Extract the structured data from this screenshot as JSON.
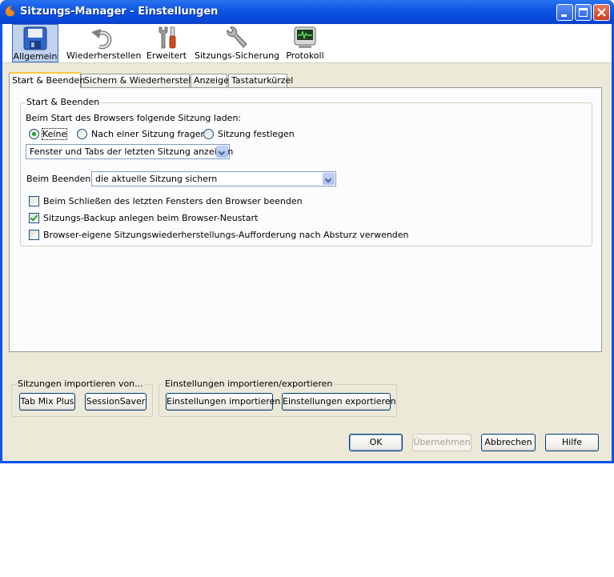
{
  "window": {
    "title": "Sitzungs-Manager - Einstellungen"
  },
  "toolbar": {
    "items": [
      {
        "label": "Allgemein"
      },
      {
        "label": "Wiederherstellen"
      },
      {
        "label": "Erweitert"
      },
      {
        "label": "Sitzungs-Sicherung"
      },
      {
        "label": "Protokoll"
      }
    ]
  },
  "tabs": [
    {
      "label": "Start & Beenden"
    },
    {
      "label": "Sichern & Wiederherstellen"
    },
    {
      "label": "Anzeige"
    },
    {
      "label": "Tastaturkürzel"
    }
  ],
  "startup": {
    "group_label": "Start & Beenden",
    "load_label": "Beim Start des Browsers folgende Sitzung laden:",
    "radio_none": "Keine",
    "radio_ask": "Nach einer Sitzung fragen",
    "radio_set": "Sitzung festlegen",
    "display_select": "Fenster und Tabs der letzten Sitzung anzeigen",
    "exit_label": "Beim Beenden:",
    "exit_select": "die aktuelle Sitzung sichern",
    "check_close_browser": "Beim Schließen des letzten Fensters den Browser beenden",
    "check_backup": "Sitzungs-Backup anlegen beim Browser-Neustart",
    "check_crash": "Browser-eigene Sitzungswiederherstellungs-Aufforderung nach Absturz verwenden"
  },
  "import_sessions": {
    "label": "Sitzungen importieren von...",
    "tmp_button": "Tab Mix Plus",
    "saver_button": "SessionSaver"
  },
  "import_settings": {
    "label": "Einstellungen importieren/exportieren",
    "import_button": "Einstellungen importieren",
    "export_button": "Einstellungen exportieren"
  },
  "dialog": {
    "ok": "OK",
    "apply": "Übernehmen",
    "cancel": "Abbrechen",
    "help": "Hilfe"
  },
  "colors": {
    "titlebar": "#0a54e8",
    "face": "#ece9d8",
    "panel": "#fcfcfe",
    "selected": "#c1d2ee"
  }
}
